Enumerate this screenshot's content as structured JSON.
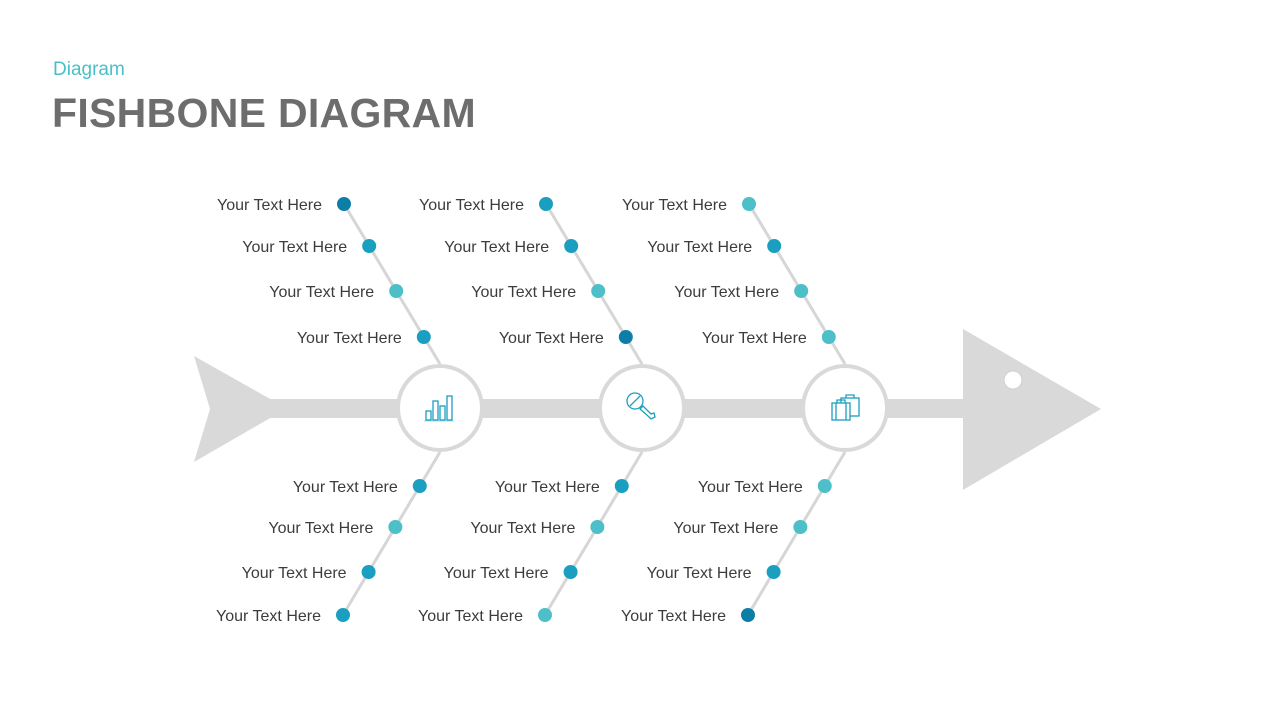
{
  "header": {
    "subtitle": "Diagram",
    "title": "FISHBONE DIAGRAM"
  },
  "colors": {
    "dark": "#0d7ea8",
    "mid": "#1a9fc1",
    "light": "#4cbfc9",
    "bone": "#d9d9d9",
    "text": "#3c3c3c",
    "accent": "#4bbfc8"
  },
  "nodes": [
    {
      "icon": "bar-chart-icon"
    },
    {
      "icon": "microphone-icon"
    },
    {
      "icon": "briefcase-icon"
    }
  ],
  "branches": [
    {
      "node": 0,
      "side": "top",
      "items": [
        {
          "label": "Your Text Here",
          "tone": "dark"
        },
        {
          "label": "Your Text Here",
          "tone": "mid"
        },
        {
          "label": "Your Text Here",
          "tone": "light"
        },
        {
          "label": "Your Text Here",
          "tone": "mid"
        }
      ]
    },
    {
      "node": 1,
      "side": "top",
      "items": [
        {
          "label": "Your Text Here",
          "tone": "mid"
        },
        {
          "label": "Your Text Here",
          "tone": "mid"
        },
        {
          "label": "Your Text Here",
          "tone": "light"
        },
        {
          "label": "Your Text Here",
          "tone": "dark"
        }
      ]
    },
    {
      "node": 2,
      "side": "top",
      "items": [
        {
          "label": "Your Text Here",
          "tone": "light"
        },
        {
          "label": "Your Text Here",
          "tone": "mid"
        },
        {
          "label": "Your Text Here",
          "tone": "light"
        },
        {
          "label": "Your Text Here",
          "tone": "light"
        }
      ]
    },
    {
      "node": 0,
      "side": "bottom",
      "items": [
        {
          "label": "Your Text Here",
          "tone": "mid"
        },
        {
          "label": "Your Text Here",
          "tone": "light"
        },
        {
          "label": "Your Text Here",
          "tone": "mid"
        },
        {
          "label": "Your Text Here",
          "tone": "mid"
        }
      ]
    },
    {
      "node": 1,
      "side": "bottom",
      "items": [
        {
          "label": "Your Text Here",
          "tone": "mid"
        },
        {
          "label": "Your Text Here",
          "tone": "light"
        },
        {
          "label": "Your Text Here",
          "tone": "mid"
        },
        {
          "label": "Your Text Here",
          "tone": "light"
        }
      ]
    },
    {
      "node": 2,
      "side": "bottom",
      "items": [
        {
          "label": "Your Text Here",
          "tone": "light"
        },
        {
          "label": "Your Text Here",
          "tone": "light"
        },
        {
          "label": "Your Text Here",
          "tone": "mid"
        },
        {
          "label": "Your Text Here",
          "tone": "dark"
        }
      ]
    }
  ]
}
